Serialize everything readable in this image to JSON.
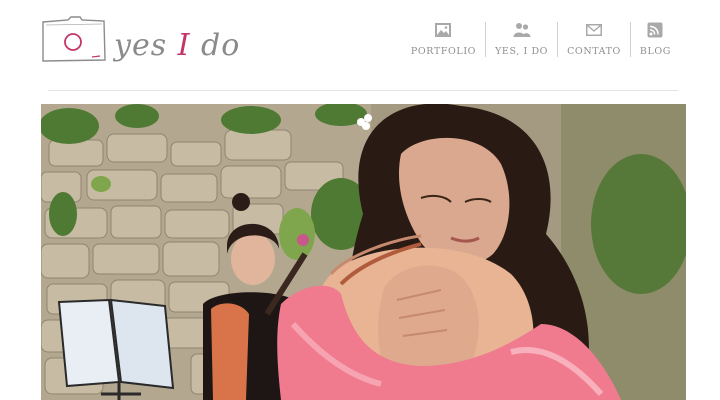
{
  "logo": {
    "text_pre": "yes ",
    "text_accent": "I",
    "text_post": " do",
    "accent_color": "#c4356a"
  },
  "nav": {
    "items": [
      {
        "label": "PORTFOLIO",
        "icon": "image-icon"
      },
      {
        "label": "YES, I DO",
        "icon": "users-icon"
      },
      {
        "label": "CONTATO",
        "icon": "envelope-icon"
      },
      {
        "label": "BLOG",
        "icon": "rss-icon"
      }
    ]
  },
  "hero": {
    "description_icon": "photo-icon"
  }
}
